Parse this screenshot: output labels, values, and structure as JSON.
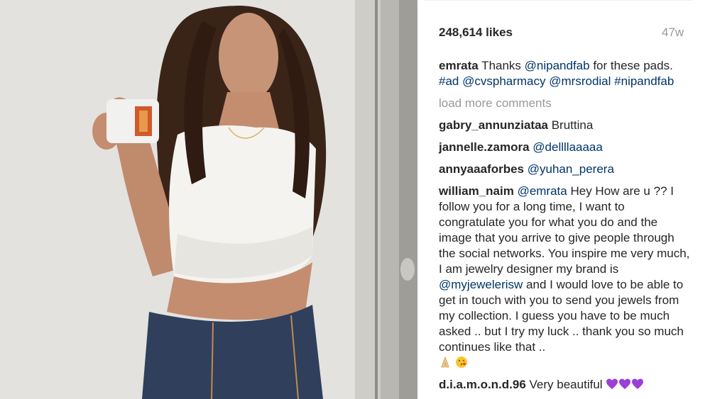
{
  "post": {
    "likes": "248,614 likes",
    "age": "47w"
  },
  "caption": {
    "username": "emrata",
    "text_1": " Thanks ",
    "mention_1": "@nipandfab",
    "text_2": " for these pads. ",
    "hashtag_1": "#ad",
    "text_3": " ",
    "mention_2": "@cvspharmacy",
    "text_4": " ",
    "mention_3": "@mrsrodial",
    "text_5": " ",
    "hashtag_2": "#nipandfab"
  },
  "load_more": "load more comments",
  "comments": {
    "c1": {
      "username": "gabry_annunziataa",
      "text": " Bruttina"
    },
    "c2": {
      "username": "jannelle.zamora",
      "mention": "@dellllaaaaa"
    },
    "c3": {
      "username": "annyaaaforbes",
      "mention": "@yuhan_perera"
    },
    "c4": {
      "username": "william_naim",
      "mention_1": "@emrata",
      "text_1": " Hey How are u ?? I follow you for a long time, I want to congratulate you for what you do and the image that you arrive to give people through the social networks. You inspire me very much, I am jewelry designer my brand is ",
      "mention_2": "@myjewelerisw",
      "text_2": " and I would love to be able to get in touch with you to send you jewels from my collection. I guess you have to be much asked .. but I try my luck .. thank you so much continues like that .. "
    },
    "c5": {
      "username": "d.i.a.m.o.n.d.96",
      "text": " Very beautiful "
    }
  },
  "icons": {
    "praying_hands": "praying-hands-icon",
    "kiss_face": "kiss-face-icon",
    "purple_heart": "purple-heart-icon"
  },
  "colors": {
    "text": "#262626",
    "muted": "#999999",
    "link": "#003569",
    "purple_heart": "#9b3fd6"
  }
}
